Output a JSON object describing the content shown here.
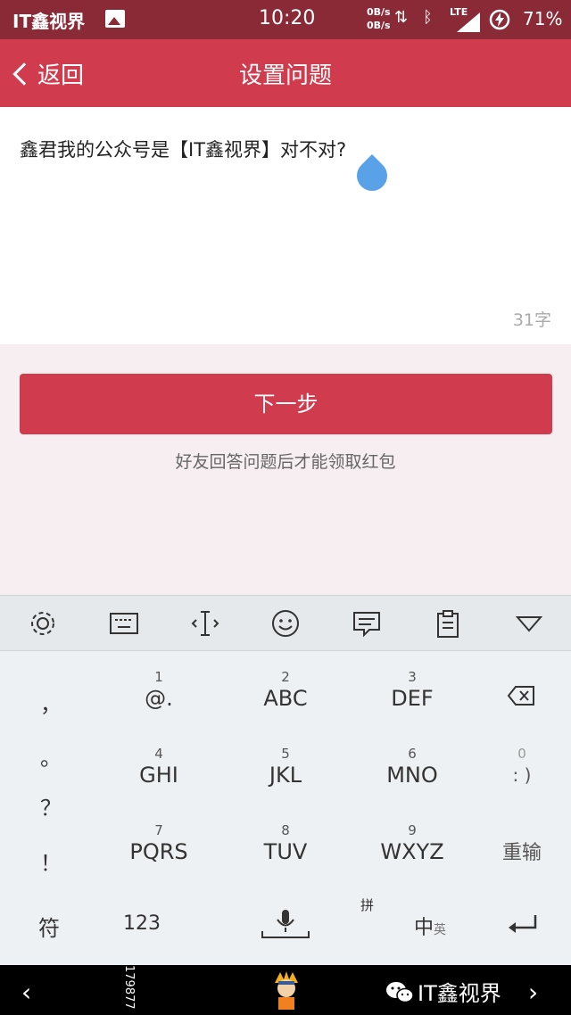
{
  "status_bar": {
    "left_label": "IT鑫视界",
    "time": "10:20",
    "net_up": "0B/s",
    "net_down": "0B/s",
    "lte_label": "LTE",
    "battery": "71%"
  },
  "header": {
    "back_label": "返回",
    "title": "设置问题"
  },
  "question": {
    "text": "鑫君我的公众号是【IT鑫视界】对不对?",
    "char_count": "31字"
  },
  "actions": {
    "next_label": "下一步",
    "hint": "好友回答问题后才能领取红包"
  },
  "keyboard": {
    "toolbar_icons": [
      "gear-icon",
      "keyboard-icon",
      "cursor-icon",
      "emoji-icon",
      "message-icon",
      "clipboard-icon",
      "collapse-icon"
    ],
    "punctuation": [
      "，",
      "。",
      "？",
      "！"
    ],
    "keys": [
      {
        "num": "1",
        "label": "@."
      },
      {
        "num": "2",
        "label": "ABC"
      },
      {
        "num": "3",
        "label": "DEF"
      },
      {
        "num": "4",
        "label": "GHI"
      },
      {
        "num": "5",
        "label": "JKL"
      },
      {
        "num": "6",
        "label": "MNO"
      },
      {
        "num": "7",
        "label": "PQRS"
      },
      {
        "num": "8",
        "label": "TUV"
      },
      {
        "num": "9",
        "label": "WXYZ"
      }
    ],
    "zero_key": {
      "num": "0",
      "label": ": )"
    },
    "retype_label": "重输",
    "symbol_label": "符",
    "num_label": "123",
    "pinyin_label": "拼",
    "zhong_label": "中",
    "ying_label": "英"
  },
  "nav_bar": {
    "vertical_text": "179877",
    "brand": "IT鑫视界"
  },
  "colors": {
    "status_bar": "#8b2a37",
    "accent": "#d03c4d",
    "page_bg": "#f6eef0",
    "keyboard_bg": "#eef1f4",
    "cursor_drop": "#5aa2e8"
  }
}
